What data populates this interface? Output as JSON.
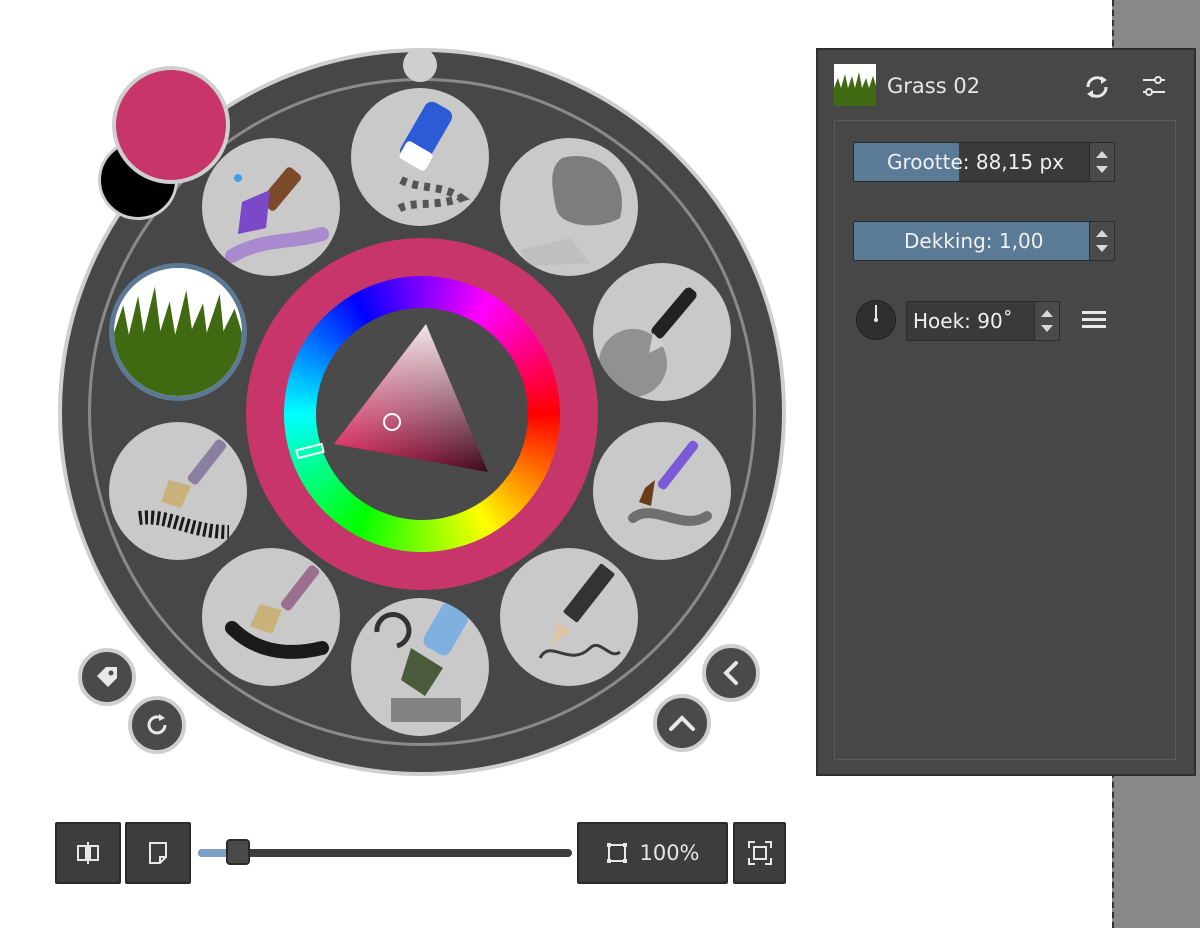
{
  "colors": {
    "foreground": "#c8356a",
    "background": "#000000",
    "accent": "#5a7a96",
    "panel": "#474747"
  },
  "palette": {
    "brush_slots": [
      {
        "name": "airbrush-soft",
        "icon": "airbrush-icon"
      },
      {
        "name": "eraser-pen",
        "icon": "eraser-icon"
      },
      {
        "name": "blender-blob",
        "icon": "blender-icon"
      },
      {
        "name": "ink-pen",
        "icon": "pen-icon"
      },
      {
        "name": "watercolor-brush",
        "icon": "watercolor-brush-icon"
      },
      {
        "name": "pencil",
        "icon": "pencil-icon"
      },
      {
        "name": "marker-rotate",
        "icon": "marker-icon"
      },
      {
        "name": "fan-brush",
        "icon": "fan-brush-icon"
      },
      {
        "name": "bristle-brush",
        "icon": "bristle-brush-icon"
      },
      {
        "name": "grass",
        "icon": "grass-icon",
        "selected": true
      },
      {
        "name": "wet-brush",
        "icon": "wet-brush-icon"
      }
    ],
    "buttons": [
      "tag-icon",
      "refresh-icon",
      "chevron-left-icon",
      "chevron-up-icon"
    ]
  },
  "toolbar": {
    "zoom_label": "100%",
    "slider_value": 0.1
  },
  "brush_panel": {
    "preset_name": "Grass 02",
    "size": {
      "label": "Grootte: 88,15 px",
      "fraction": 0.42
    },
    "opacity": {
      "label": "Dekking: 1,00",
      "fraction": 1.0
    },
    "angle": {
      "label": "Hoek: 90˚"
    }
  }
}
